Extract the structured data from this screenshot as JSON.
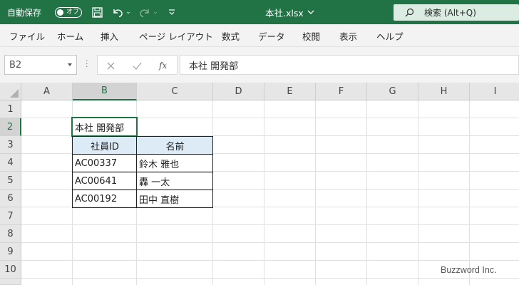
{
  "titlebar": {
    "autosave_label": "自動保存",
    "autosave_state": "オフ",
    "filename": "本社.xlsx",
    "search_placeholder": "検索 (Alt+Q)",
    "accent_color": "#217346"
  },
  "ribbon": {
    "tabs": [
      "ファイル",
      "ホーム",
      "挿入",
      "ページ レイアウト",
      "数式",
      "データ",
      "校閲",
      "表示",
      "ヘルプ"
    ]
  },
  "formula_bar": {
    "name_box": "B2",
    "fx_label": "fx",
    "content": "本社 開発部"
  },
  "sheet": {
    "columns": [
      "A",
      "B",
      "C",
      "D",
      "E",
      "F",
      "G",
      "H",
      "I"
    ],
    "rows": [
      "1",
      "2",
      "3",
      "4",
      "5",
      "6",
      "7",
      "8",
      "9",
      "10"
    ],
    "selected_cell": "B2",
    "b2": "本社 開発部",
    "table": {
      "headers": [
        "社員ID",
        "名前"
      ],
      "rows": [
        [
          "AC00337",
          "鈴木 雅也"
        ],
        [
          "AC00641",
          "轟 一太"
        ],
        [
          "AC00192",
          "田中 直樹"
        ]
      ],
      "header_fill": "#ddebf7"
    }
  },
  "watermark": "Buzzword Inc."
}
